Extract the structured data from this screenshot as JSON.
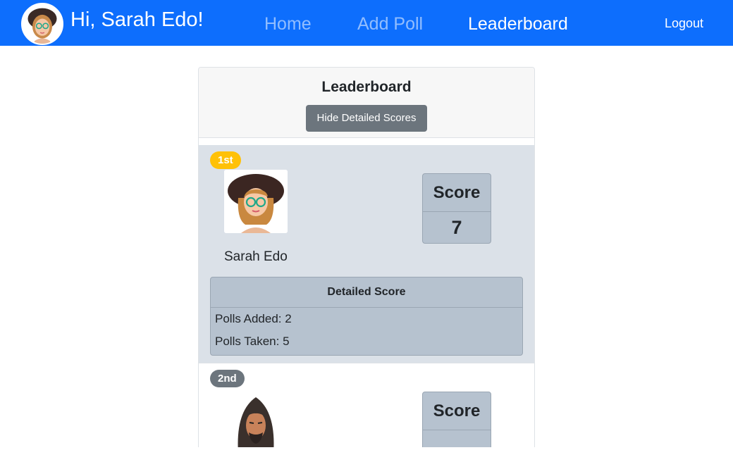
{
  "navbar": {
    "greeting": "Hi, Sarah Edo!",
    "links": [
      {
        "label": "Home",
        "active": false
      },
      {
        "label": "Add Poll",
        "active": false
      },
      {
        "label": "Leaderboard",
        "active": true
      }
    ],
    "logout_label": "Logout",
    "brand_color": "#0d6efd"
  },
  "leaderboard": {
    "title": "Leaderboard",
    "toggle_button_label": "Hide Detailed Scores",
    "entries": [
      {
        "rank": "1st",
        "name": "Sarah Edo",
        "avatar_icon": "woman-with-hat-glasses-avatar",
        "score_label": "Score",
        "score": "7",
        "detail_title": "Detailed Score",
        "polls_added": "Polls Added: 2",
        "polls_taken": "Polls Taken: 5",
        "badge_color": "#ffc107"
      },
      {
        "rank": "2nd",
        "avatar_icon": "man-long-hair-beard-avatar",
        "score_label": "Score",
        "badge_color": "#6c757d"
      }
    ]
  }
}
